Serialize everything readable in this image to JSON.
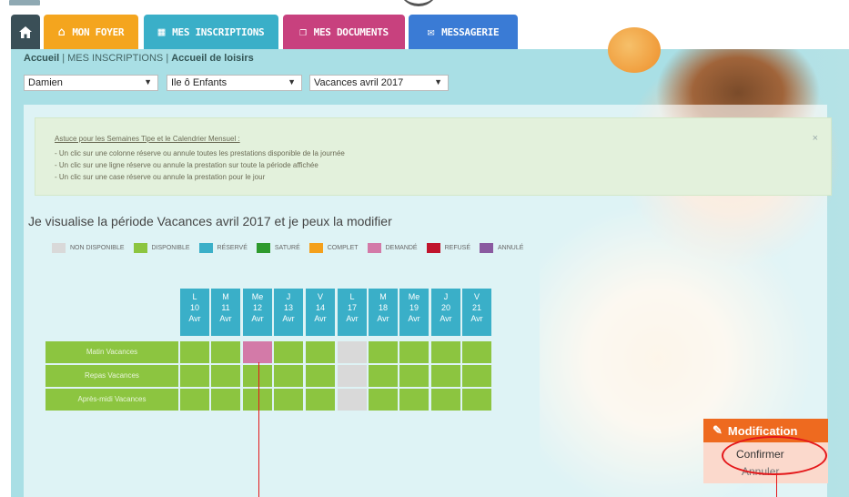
{
  "nav": {
    "home_icon": "home-icon",
    "tabs": [
      {
        "label": "MON FOYER",
        "icon": "house-icon",
        "color": "#f4a51e"
      },
      {
        "label": "MES INSCRIPTIONS",
        "icon": "calendar-icon",
        "color": "#3aafc8"
      },
      {
        "label": "MES DOCUMENTS",
        "icon": "documents-icon",
        "color": "#c8417e"
      },
      {
        "label": "MESSAGERIE",
        "icon": "envelope-icon",
        "color": "#3a7bd5"
      }
    ]
  },
  "breadcrumb": {
    "home": "Accueil",
    "sep": "|",
    "section": "MES INSCRIPTIONS",
    "current": "Accueil de loisirs"
  },
  "filters": {
    "child": "Damien",
    "site": "Ile ô Enfants",
    "period": "Vacances avril 2017"
  },
  "tip": {
    "title": "Astuce pour les Semaines Tipe et le Calendrier Mensuel :",
    "lines": [
      "- Un clic sur une colonne réserve ou annule toutes les prestations disponible de la journée",
      "- Un clic sur une ligne réserve ou annule la prestation sur toute la période affichée",
      "- Un clic sur une case réserve ou annule la prestation pour le jour"
    ],
    "close": "×"
  },
  "heading": "Je visualise la période Vacances avril 2017 et je peux la modifier",
  "legend": [
    {
      "label": "NON DISPONIBLE",
      "color": "#d9d9d9"
    },
    {
      "label": "DISPONIBLE",
      "color": "#8cc540"
    },
    {
      "label": "RÉSERVÉ",
      "color": "#3aafc8"
    },
    {
      "label": "SATURÉ",
      "color": "#2e9a2e"
    },
    {
      "label": "COMPLET",
      "color": "#f4a01c"
    },
    {
      "label": "DEMANDÉ",
      "color": "#d37aa8"
    },
    {
      "label": "REFUSÉ",
      "color": "#c0142c"
    },
    {
      "label": "ANNULÉ",
      "color": "#8a5aa0"
    }
  ],
  "days": [
    {
      "d": "L",
      "n": "10",
      "m": "Avr"
    },
    {
      "d": "M",
      "n": "11",
      "m": "Avr"
    },
    {
      "d": "Me",
      "n": "12",
      "m": "Avr"
    },
    {
      "d": "J",
      "n": "13",
      "m": "Avr"
    },
    {
      "d": "V",
      "n": "14",
      "m": "Avr"
    },
    {
      "d": "L",
      "n": "17",
      "m": "Avr"
    },
    {
      "d": "M",
      "n": "18",
      "m": "Avr"
    },
    {
      "d": "Me",
      "n": "19",
      "m": "Avr"
    },
    {
      "d": "J",
      "n": "20",
      "m": "Avr"
    },
    {
      "d": "V",
      "n": "21",
      "m": "Avr"
    }
  ],
  "rows": [
    {
      "label": "Matin Vacances",
      "status": [
        "dispo",
        "dispo",
        "demande",
        "dispo",
        "dispo",
        "nondispo",
        "dispo",
        "dispo",
        "dispo",
        "dispo"
      ]
    },
    {
      "label": "Repas Vacances",
      "status": [
        "dispo",
        "dispo",
        "dispo",
        "dispo",
        "dispo",
        "nondispo",
        "dispo",
        "dispo",
        "dispo",
        "dispo"
      ]
    },
    {
      "label": "Après-midi Vacances",
      "status": [
        "dispo",
        "dispo",
        "dispo",
        "dispo",
        "dispo",
        "nondispo",
        "dispo",
        "dispo",
        "dispo",
        "dispo"
      ]
    }
  ],
  "status_colors": {
    "dispo": "#8cc540",
    "nondispo": "#d9d9d9",
    "demande": "#d37aa8"
  },
  "menu": {
    "title": "Modification",
    "confirm": "Confirmer",
    "cancel": "Annuler",
    "icon": "pencil-icon"
  }
}
